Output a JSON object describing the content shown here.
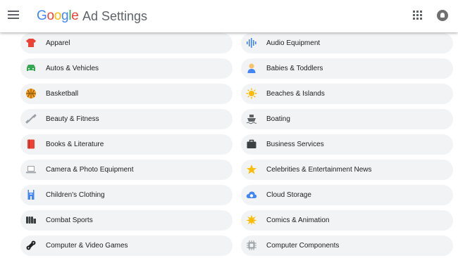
{
  "header": {
    "logo_letters": [
      "G",
      "o",
      "o",
      "g",
      "l",
      "e"
    ],
    "product": "Ad Settings",
    "icons": {
      "menu": "hamburger-menu-icon",
      "apps": "apps-grid-icon",
      "account": "account-icon"
    }
  },
  "topics": {
    "left": [
      {
        "label": "Apparel",
        "icon": "shirt-icon"
      },
      {
        "label": "Autos & Vehicles",
        "icon": "car-icon"
      },
      {
        "label": "Basketball",
        "icon": "basketball-icon"
      },
      {
        "label": "Beauty & Fitness",
        "icon": "dumbbell-icon"
      },
      {
        "label": "Books & Literature",
        "icon": "book-icon"
      },
      {
        "label": "Camera & Photo Equipment",
        "icon": "laptop-icon"
      },
      {
        "label": "Children's Clothing",
        "icon": "overalls-icon"
      },
      {
        "label": "Combat Sports",
        "icon": "boxing-glove-icon"
      },
      {
        "label": "Computer & Video Games",
        "icon": "gamepad-icon"
      }
    ],
    "right": [
      {
        "label": "Audio Equipment",
        "icon": "audio-wave-icon"
      },
      {
        "label": "Babies & Toddlers",
        "icon": "baby-icon"
      },
      {
        "label": "Beaches & Islands",
        "icon": "sun-icon"
      },
      {
        "label": "Boating",
        "icon": "boat-icon"
      },
      {
        "label": "Business Services",
        "icon": "briefcase-icon"
      },
      {
        "label": "Celebrities & Entertainment News",
        "icon": "star-icon"
      },
      {
        "label": "Cloud Storage",
        "icon": "cloud-icon"
      },
      {
        "label": "Comics & Animation",
        "icon": "burst-icon"
      },
      {
        "label": "Computer Components",
        "icon": "cpu-chip-icon"
      }
    ]
  },
  "colors": {
    "chip_background": "#f1f3f4",
    "text": "#202124",
    "google_blue": "#4285f4",
    "google_red": "#ea4335",
    "google_yellow": "#fbbc05",
    "google_green": "#34a853"
  }
}
